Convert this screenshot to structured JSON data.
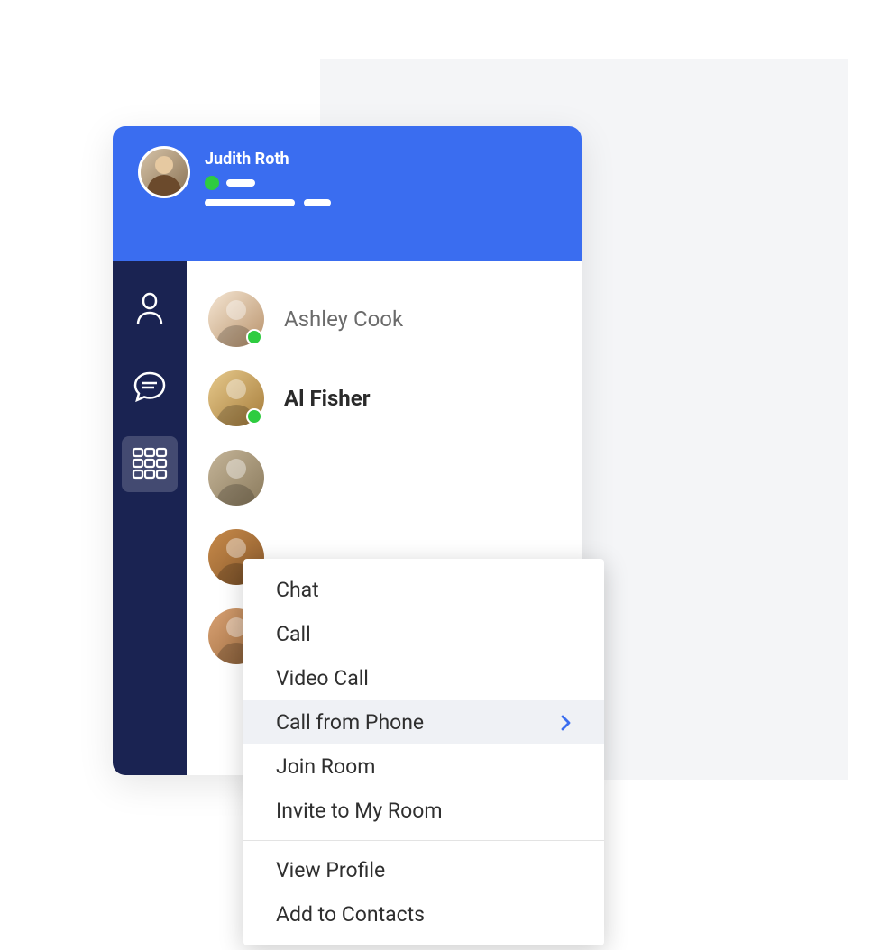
{
  "header": {
    "user_name": "Judith Roth"
  },
  "sidebar": {
    "tabs": [
      "contacts",
      "chat",
      "dialpad"
    ],
    "active_index": 2
  },
  "contacts": [
    {
      "name": "Ashley Cook",
      "online": true,
      "selected": false,
      "avatar_color": "avatar-1"
    },
    {
      "name": "Al Fisher",
      "online": true,
      "selected": true,
      "avatar_color": "avatar-2"
    }
  ],
  "extra_avatars": [
    "avatar-3",
    "avatar-4",
    "avatar-5"
  ],
  "context_menu": {
    "groups": [
      [
        {
          "label": "Chat",
          "submenu": false
        },
        {
          "label": "Call",
          "submenu": false
        },
        {
          "label": "Video Call",
          "submenu": false
        },
        {
          "label": "Call from Phone",
          "submenu": true,
          "hovered": true
        },
        {
          "label": "Join Room",
          "submenu": false
        },
        {
          "label": "Invite to My Room",
          "submenu": false
        }
      ],
      [
        {
          "label": "View Profile",
          "submenu": false
        },
        {
          "label": "Add to Contacts",
          "submenu": false
        }
      ]
    ]
  },
  "colors": {
    "primary": "#3a6df0",
    "sidebar_bg": "#1a2352",
    "online": "#2ecc40"
  }
}
